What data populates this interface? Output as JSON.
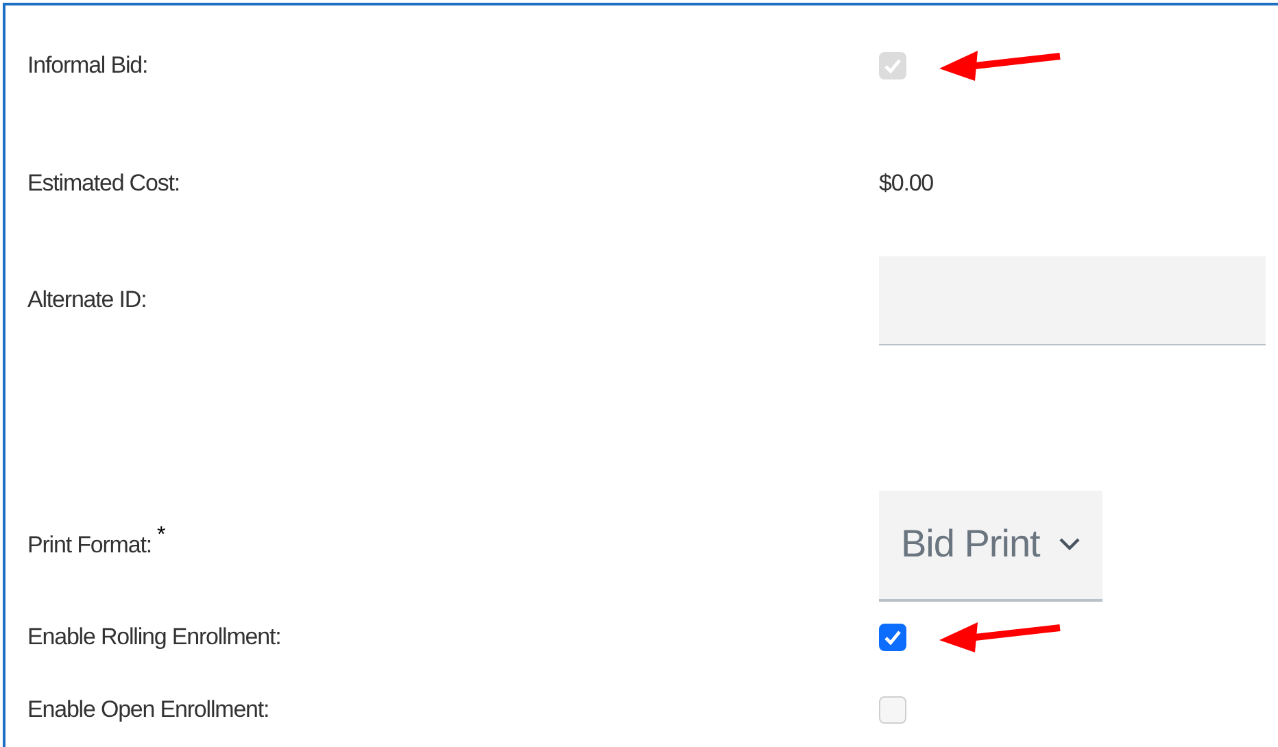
{
  "rows": [
    {
      "kind": "checkbox",
      "label": "Informal Bid:",
      "checked": true,
      "disabled": true,
      "arrow": true
    },
    {
      "kind": "text",
      "label": "Estimated Cost:",
      "value": "$0.00"
    },
    {
      "kind": "input",
      "label": "Alternate ID:"
    },
    {
      "kind": "select",
      "label": "Print Format:",
      "required_mark": "*",
      "value": "Bid Print"
    },
    {
      "kind": "checkbox",
      "label": "Enable Rolling Enrollment:",
      "checked": true,
      "disabled": false,
      "arrow": true
    },
    {
      "kind": "checkbox",
      "label": "Enable Open Enrollment:",
      "checked": false,
      "disabled": false,
      "arrow": false
    }
  ]
}
